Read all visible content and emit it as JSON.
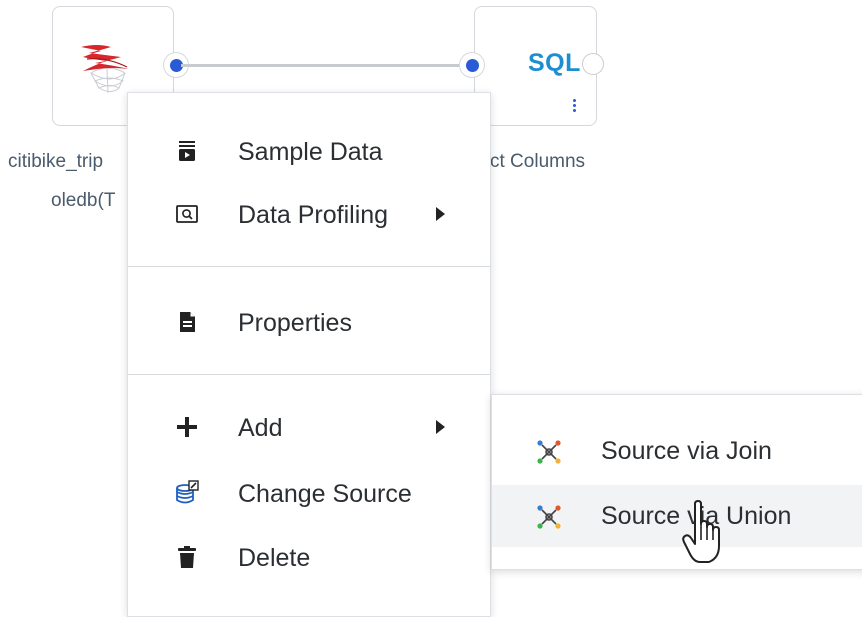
{
  "canvas": {
    "source_node": {
      "icon": "sql-server-icon",
      "label_line1": "citibike_trip",
      "label_line2": "oledb(T"
    },
    "sql_node": {
      "logo_text": "SQL",
      "label": "ct Columns"
    }
  },
  "context_menu": {
    "items": [
      {
        "label": "Sample Data",
        "icon": "sample-data-icon"
      },
      {
        "label": "Data Profiling",
        "icon": "data-profiling-icon",
        "has_submenu": true
      },
      {
        "label": "Properties",
        "icon": "properties-icon"
      },
      {
        "label": "Add",
        "icon": "plus-icon",
        "has_submenu": true
      },
      {
        "label": "Change Source",
        "icon": "change-source-icon"
      },
      {
        "label": "Delete",
        "icon": "trash-icon"
      }
    ]
  },
  "submenu": {
    "items": [
      {
        "label": "Source via Join",
        "icon": "join-icon"
      },
      {
        "label": "Source via Union",
        "icon": "union-icon",
        "hovered": true
      }
    ]
  },
  "colors": {
    "port": "#2a5bd7",
    "sql_logo": "#1d8fd0",
    "node_label": "#4a5b6c",
    "menu_text": "#2b2f33",
    "hover_background": "#f2f3f5"
  }
}
